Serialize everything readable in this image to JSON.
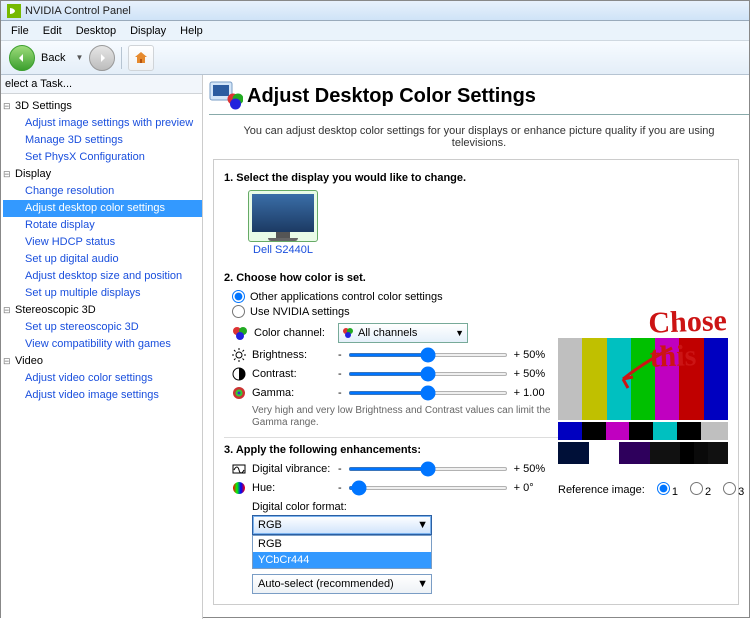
{
  "window": {
    "title": "NVIDIA Control Panel"
  },
  "menu": [
    "File",
    "Edit",
    "Desktop",
    "Display",
    "Help"
  ],
  "toolbar": {
    "back": "Back"
  },
  "sidebar": {
    "task_label": "elect a Task...",
    "groups": [
      {
        "label": "3D Settings",
        "items": [
          "Adjust image settings with preview",
          "Manage 3D settings",
          "Set PhysX Configuration"
        ]
      },
      {
        "label": "Display",
        "items": [
          "Change resolution",
          "Adjust desktop color settings",
          "Rotate display",
          "View HDCP status",
          "Set up digital audio",
          "Adjust desktop size and position",
          "Set up multiple displays"
        ],
        "selected": 1
      },
      {
        "label": "Stereoscopic 3D",
        "items": [
          "Set up stereoscopic 3D",
          "View compatibility with games"
        ]
      },
      {
        "label": "Video",
        "items": [
          "Adjust video color settings",
          "Adjust video image settings"
        ]
      }
    ]
  },
  "page": {
    "title": "Adjust Desktop Color Settings",
    "intro": "You can adjust desktop color settings for your displays or enhance picture quality if you are using televisions.",
    "sec1": "1. Select the display you would like to change.",
    "monitor_name": "Dell S2440L",
    "sec2": "2. Choose how color is set.",
    "radio_other": "Other applications control color settings",
    "radio_nvidia": "Use NVIDIA settings",
    "color_channel_label": "Color channel:",
    "color_channel_value": "All channels",
    "brightness_label": "Brightness:",
    "brightness_value": "+  50%",
    "contrast_label": "Contrast:",
    "contrast_value": "+  50%",
    "gamma_label": "Gamma:",
    "gamma_value": "+  1.00",
    "note": "Very high and very low Brightness and Contrast values can limit the Gamma range.",
    "sec3": "3. Apply the following enhancements:",
    "vibrance_label": "Digital vibrance:",
    "vibrance_value": "+  50%",
    "hue_label": "Hue:",
    "hue_value": "+  0°",
    "dcf_label": "Digital color format:",
    "dcf_value": "RGB",
    "dcf_options": [
      "RGB",
      "YCbCr444"
    ],
    "autoselect": "Auto-select (recommended)",
    "ref_label": "Reference image:"
  },
  "annotation": "Chose this"
}
